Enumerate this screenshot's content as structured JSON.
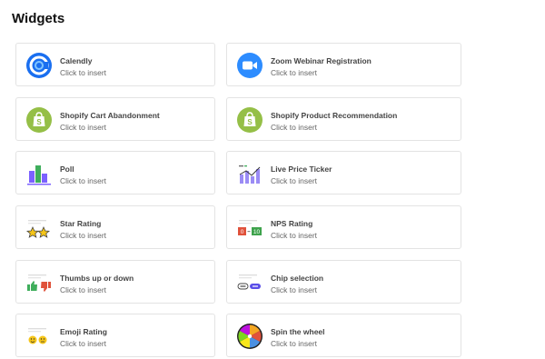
{
  "header": {
    "title": "Widgets"
  },
  "widgets": [
    {
      "name": "Calendly",
      "action": "Click to insert",
      "icon": "calendly-icon"
    },
    {
      "name": "Zoom Webinar Registration",
      "action": "Click to insert",
      "icon": "zoom-icon"
    },
    {
      "name": "Shopify Cart Abandonment",
      "action": "Click to insert",
      "icon": "shopify-icon"
    },
    {
      "name": "Shopify Product Recommendation",
      "action": "Click to insert",
      "icon": "shopify-icon"
    },
    {
      "name": "Poll",
      "action": "Click to insert",
      "icon": "poll-icon"
    },
    {
      "name": "Live Price Ticker",
      "action": "Click to insert",
      "icon": "price-ticker-icon"
    },
    {
      "name": "Star Rating",
      "action": "Click to insert",
      "icon": "star-rating-icon"
    },
    {
      "name": "NPS Rating",
      "action": "Click to insert",
      "icon": "nps-icon",
      "icon_text": [
        "0",
        "10"
      ]
    },
    {
      "name": "Thumbs up or down",
      "action": "Click to insert",
      "icon": "thumbs-icon"
    },
    {
      "name": "Chip selection",
      "action": "Click to insert",
      "icon": "chip-icon"
    },
    {
      "name": "Emoji Rating",
      "action": "Click to insert",
      "icon": "emoji-icon"
    },
    {
      "name": "Spin the wheel",
      "action": "Click to insert",
      "icon": "wheel-icon"
    }
  ],
  "colors": {
    "calendly": "#1a6ff0",
    "zoom": "#2d8cff",
    "shopify": "#95bf47",
    "poll": "#7b61ff",
    "nps_low": "#e0523b",
    "nps_high": "#3fa34d"
  }
}
